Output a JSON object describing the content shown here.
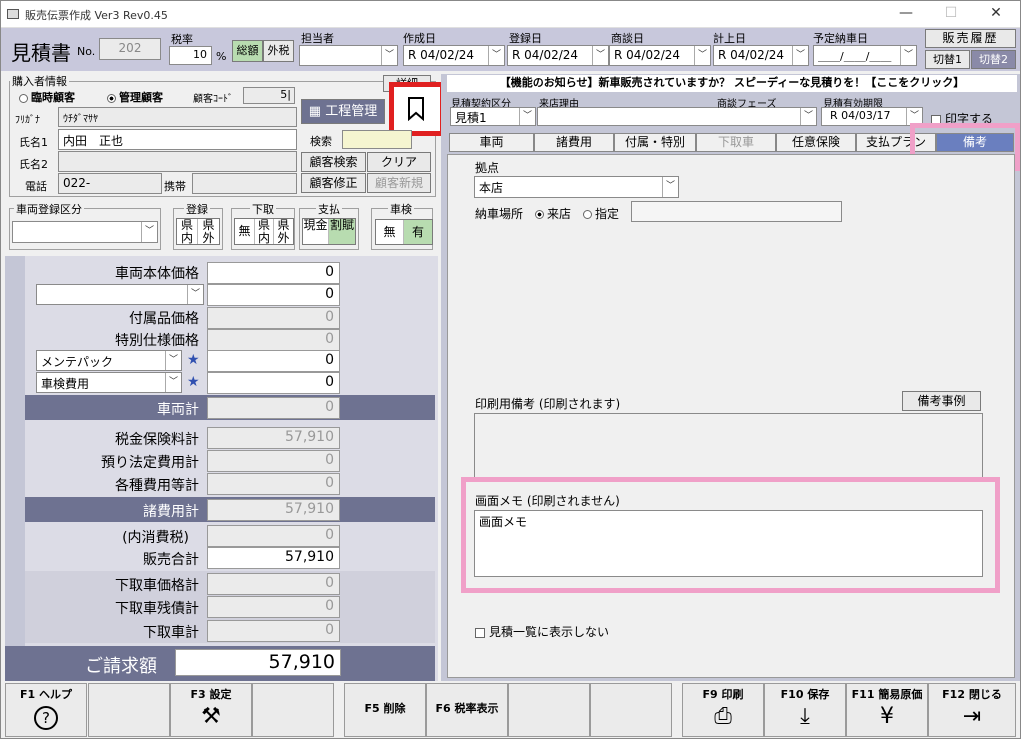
{
  "window": {
    "title": "販売伝票作成 Ver3 Rev0.45",
    "minimize": "—",
    "maximize": "☐",
    "close": "✕"
  },
  "header": {
    "doc_type": "見積書",
    "no_label": "No.",
    "no_value": "202",
    "tax_label": "税率",
    "tax_value": "10",
    "tax_unit": "%",
    "tax_modes": [
      "総額",
      "外税"
    ],
    "tanto_label": "担当者",
    "created_label": "作成日",
    "created_value": "R 04/02/24",
    "registered_label": "登録日",
    "registered_value": "R 04/02/24",
    "negotiation_label": "商談日",
    "negotiation_value": "R 04/02/24",
    "posting_label": "計上日",
    "posting_value": "R 04/02/24",
    "delivery_label": "予定納車日",
    "delivery_value": "＿＿/＿＿/＿＿",
    "history_button": "販売履歴",
    "switch1": "切替1",
    "switch2": "切替2"
  },
  "buyer": {
    "group_title": "購入者情報",
    "detail_button": "詳細",
    "radio_temp": "臨時顧客",
    "radio_managed": "管理顧客",
    "code_label": "顧客ｺｰﾄﾞ",
    "code_value": "5|",
    "furigana_label": "ﾌﾘｶﾞﾅ",
    "furigana_value": "ｳﾁﾀﾞﾏｻﾔ",
    "name1_label": "氏名1",
    "name1_value": "内田　正也",
    "name2_label": "氏名2",
    "name2_value": "",
    "phone_label": "電話",
    "phone_value": "022-",
    "mobile_label": "携帯",
    "mobile_value": "",
    "process_button": "工程管理",
    "search_label": "検索",
    "customer_search": "顧客検索",
    "clear": "クリア",
    "customer_edit": "顧客修正",
    "customer_new": "顧客新規"
  },
  "vehicle_reg": {
    "class_label": "車両登録区分",
    "reg_label": "登録",
    "reg_opts": [
      "県内",
      "県外"
    ],
    "trade_label": "下取",
    "trade_opts": [
      "無",
      "県内",
      "県外"
    ],
    "pay_label": "支払",
    "pay_opts": [
      "現金",
      "割賦"
    ],
    "inspect_label": "車検",
    "inspect_opts": [
      "無",
      "有"
    ]
  },
  "pricing": {
    "body_price_label": "車両本体価格",
    "body_price": "0",
    "sub_price": "0",
    "accessories_label": "付属品価格",
    "accessories": "0",
    "special_label": "特別仕様価格",
    "special": "0",
    "maint_select": "メンテパック",
    "maint_value": "0",
    "inspect_select": "車検費用",
    "inspect_value": "0",
    "vehicle_total_label": "車両計",
    "vehicle_total": "0",
    "tax_ins_label": "税金保険料計",
    "tax_ins": "57,910",
    "deposit_label": "預り法定費用計",
    "deposit": "0",
    "fees_label": "各種費用等計",
    "fees": "0",
    "misc_total_label": "諸費用計",
    "misc_total": "57,910",
    "incl_tax_label": "(内消費税)",
    "incl_tax": "0",
    "sales_total_label": "販売合計",
    "sales_total": "57,910",
    "trade_price_label": "下取車価格計",
    "trade_price": "0",
    "trade_balance_label": "下取車残債計",
    "trade_balance": "0",
    "trade_total_label": "下取車計",
    "trade_total": "0",
    "billing_label": "ご請求額",
    "billing": "57,910",
    "star": "★"
  },
  "notice": "【機能のお知らせ】新車販売されていますか？ スピーディーな見積りを！【ここをクリック】",
  "estimate": {
    "contract_label": "見積契約区分",
    "contract_value": "見積1",
    "visit_label": "来店理由",
    "visit_value": "",
    "phase_label": "商談フェーズ",
    "phase_value": "",
    "validity_label": "見積有効期限",
    "validity_value": "R 04/03/17",
    "stamp_label": "印字する"
  },
  "tabs": [
    "車両",
    "諸費用",
    "付属・特別",
    "下取車",
    "任意保険",
    "支払プラン",
    "備考"
  ],
  "remarks": {
    "base_label": "拠点",
    "base_value": "本店",
    "delivery_place_label": "納車場所",
    "store_label": "来店",
    "specify_label": "指定",
    "print_remarks_label": "印刷用備考 (印刷されます)",
    "examples_button": "備考事例",
    "memo_label": "画面メモ (印刷されません)",
    "memo_value": "画面メモ",
    "hide_label": "見積一覧に表示しない"
  },
  "fkeys": [
    {
      "key": "F1 ヘルプ",
      "icon": "?"
    },
    {
      "key": "",
      "icon": ""
    },
    {
      "key": "F3 設定",
      "icon": "⚒"
    },
    {
      "key": "",
      "icon": ""
    },
    {
      "key": "F5 削除",
      "icon": ""
    },
    {
      "key": "F6 税率表示",
      "icon": ""
    },
    {
      "key": "",
      "icon": ""
    },
    {
      "key": "",
      "icon": ""
    },
    {
      "key": "F9 印刷",
      "icon": "⎙"
    },
    {
      "key": "F10 保存",
      "icon": "⤓"
    },
    {
      "key": "F11 簡易原価",
      "icon": "¥"
    },
    {
      "key": "F12 閉じる",
      "icon": "⇥"
    }
  ],
  "colors": {
    "header_bg": "#c8c8dc",
    "band": "#6e7291",
    "active_tab": "#6a7fbf",
    "highlight_pink": "#f0a0c8",
    "highlight_red": "#e02020"
  }
}
